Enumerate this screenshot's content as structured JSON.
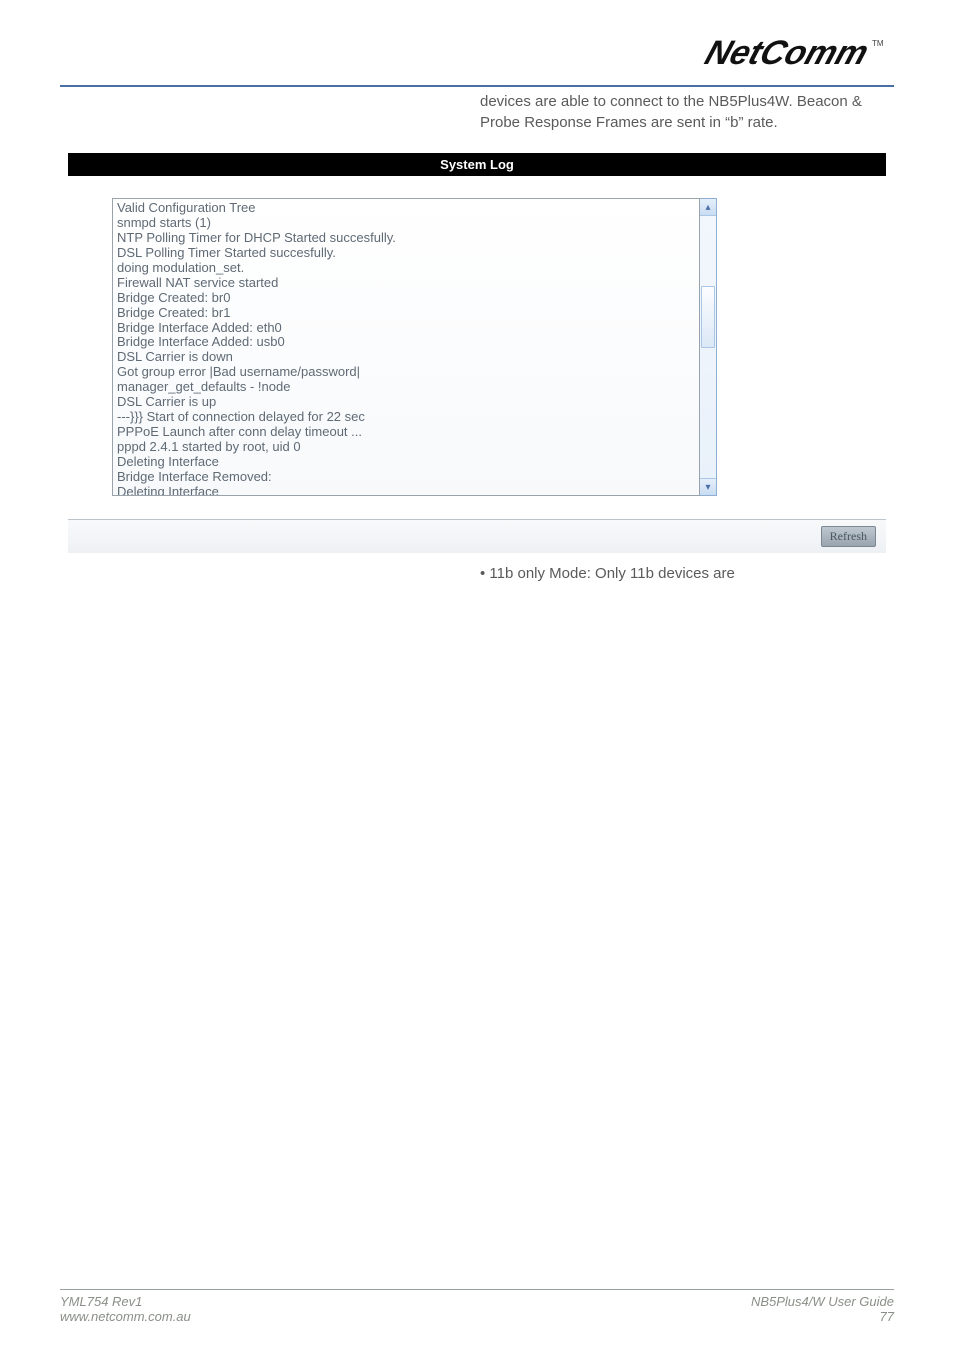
{
  "brand": {
    "name": "NetComm",
    "tm": "TM"
  },
  "intro_text": "devices are able to connect to the NB5Plus4W. Beacon & Probe Response Frames are sent in “b” rate.",
  "syslog": {
    "title": "System Log",
    "log_text": "Valid Configuration Tree\nsnmpd starts (1)\nNTP Polling Timer for DHCP Started succesfully.\nDSL Polling Timer Started succesfully.\ndoing modulation_set.\nFirewall NAT service started\nBridge Created: br0\nBridge Created: br1\nBridge Interface Added: eth0\nBridge Interface Added: usb0\nDSL Carrier is down\nGot group error |Bad username/password|\nmanager_get_defaults - !node\nDSL Carrier is up\n---}}} Start of connection delayed for 22 sec\nPPPoE Launch after conn delay timeout ...\npppd 2.4.1 started by root, uid 0\nDeleting Interface\nBridge Interface Removed:\nDeleting Interface",
    "refresh_label": "Refresh"
  },
  "bullet_text": "• 11b only Mode: Only 11b devices are",
  "footer": {
    "left_line1": "YML754 Rev1",
    "left_line2": "www.netcomm.com.au",
    "right_line1": "NB5Plus4/W User Guide",
    "right_line2": "77"
  }
}
